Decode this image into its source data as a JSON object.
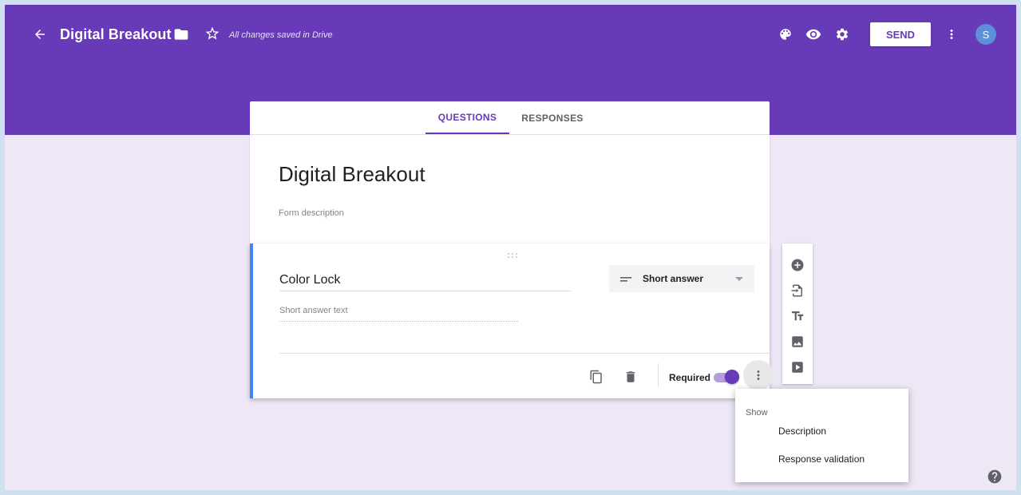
{
  "header": {
    "form_title": "Digital Breakout",
    "save_status": "All changes saved in Drive",
    "send_label": "SEND",
    "avatar_initial": "S",
    "brand_color": "#673ab7"
  },
  "tabs": [
    {
      "label": "QUESTIONS",
      "active": true
    },
    {
      "label": "RESPONSES",
      "active": false
    }
  ],
  "form": {
    "title": "Digital Breakout",
    "description_placeholder": "Form description"
  },
  "question": {
    "title": "Color Lock",
    "type_label": "Short answer",
    "answer_placeholder": "Short answer text",
    "required_label": "Required",
    "required": true
  },
  "menu": {
    "header": "Show",
    "items": [
      "Description",
      "Response validation"
    ]
  }
}
